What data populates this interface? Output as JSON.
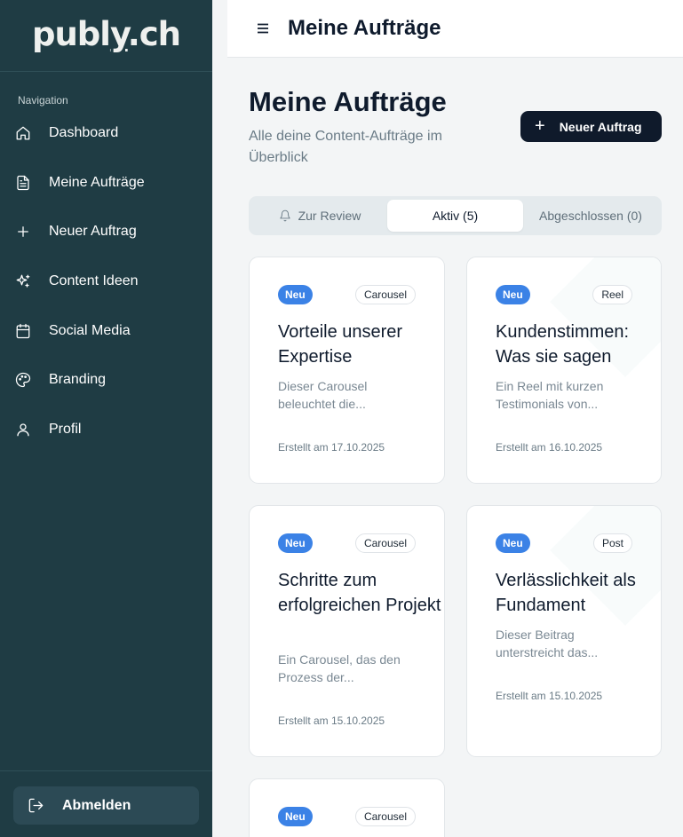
{
  "sidebar": {
    "logo": {
      "part1": "publ",
      "part2": "y",
      "part3": ".ch"
    },
    "nav_heading": "Navigation",
    "items": [
      {
        "label": "Dashboard",
        "icon": "home-icon"
      },
      {
        "label": "Meine Aufträge",
        "icon": "document-icon"
      },
      {
        "label": "Neuer Auftrag",
        "icon": "plus-icon"
      },
      {
        "label": "Content Ideen",
        "icon": "sparkles-icon"
      },
      {
        "label": "Social Media",
        "icon": "calendar-icon"
      },
      {
        "label": "Branding",
        "icon": "palette-icon"
      },
      {
        "label": "Profil",
        "icon": "user-icon"
      }
    ],
    "logout_label": "Abmelden"
  },
  "header": {
    "title": "Meine Aufträge"
  },
  "main": {
    "title": "Meine Aufträge",
    "subtitle": "Alle deine Content-Aufträge im Überblick",
    "new_button": "Neuer Auftrag",
    "tabs": [
      {
        "label": "Zur Review",
        "icon": "bell-icon",
        "active": false
      },
      {
        "label": "Aktiv (5)",
        "active": true
      },
      {
        "label": "Abgeschlossen (0)",
        "active": false
      }
    ],
    "cards": [
      {
        "status": "Neu",
        "type": "Carousel",
        "title": "Vorteile unserer Expertise",
        "desc": "Dieser Carousel beleuchtet die...",
        "date": "Erstellt am 17.10.2025"
      },
      {
        "status": "Neu",
        "type": "Reel",
        "title": "Kundenstimmen: Was sie sagen",
        "desc": "Ein Reel mit kurzen Testimonials von...",
        "date": "Erstellt am 16.10.2025"
      },
      {
        "status": "Neu",
        "type": "Carousel",
        "title": "Schritte zum erfolgreichen Projekt",
        "desc": "Ein Carousel, das den Prozess der...",
        "date": "Erstellt am 15.10.2025"
      },
      {
        "status": "Neu",
        "type": "Post",
        "title": "Verlässlichkeit als Fundament",
        "desc": "Dieser Beitrag unterstreicht das...",
        "date": "Erstellt am 15.10.2025"
      },
      {
        "status": "Neu",
        "type": "Carousel"
      }
    ]
  },
  "colors": {
    "sidebar_bg": "#1f3c44",
    "accent_dark": "#0f1a2b",
    "badge_blue": "#3b82e6",
    "page_bg": "#f3f5f6"
  }
}
